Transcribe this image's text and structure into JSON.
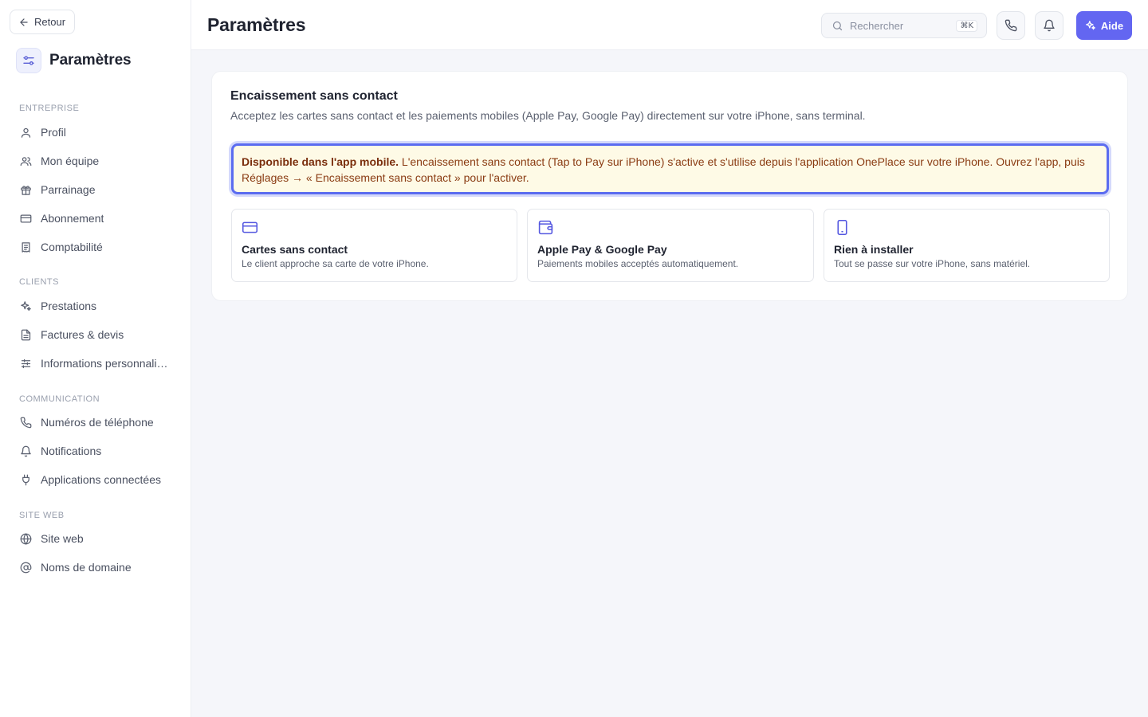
{
  "sidebar": {
    "back_label": "Retour",
    "title": "Paramètres",
    "sections": [
      {
        "label": "ENTREPRISE",
        "items": [
          {
            "label": "Profil",
            "icon": "user-icon"
          },
          {
            "label": "Mon équipe",
            "icon": "users-icon"
          },
          {
            "label": "Parrainage",
            "icon": "gift-icon"
          },
          {
            "label": "Abonnement",
            "icon": "credit-card-icon"
          },
          {
            "label": "Comptabilité",
            "icon": "receipt-icon"
          }
        ]
      },
      {
        "label": "CLIENTS",
        "items": [
          {
            "label": "Prestations",
            "icon": "sparkles-icon"
          },
          {
            "label": "Factures & devis",
            "icon": "file-text-icon"
          },
          {
            "label": "Informations personnalis…",
            "icon": "sliders-icon"
          }
        ]
      },
      {
        "label": "COMMUNICATION",
        "items": [
          {
            "label": "Numéros de téléphone",
            "icon": "phone-icon"
          },
          {
            "label": "Notifications",
            "icon": "bell-icon"
          },
          {
            "label": "Applications connectées",
            "icon": "plug-icon"
          }
        ]
      },
      {
        "label": "SITE WEB",
        "items": [
          {
            "label": "Site web",
            "icon": "globe-icon"
          },
          {
            "label": "Noms de domaine",
            "icon": "at-sign-icon"
          }
        ]
      }
    ]
  },
  "header": {
    "title": "Paramètres",
    "search_placeholder": "Rechercher",
    "search_shortcut": "⌘K",
    "help_label": "Aide"
  },
  "main": {
    "card_title": "Encaissement sans contact",
    "card_subtitle": "Acceptez les cartes sans contact et les paiements mobiles (Apple Pay, Google Pay) directement sur votre iPhone, sans terminal.",
    "notice_bold": "Disponible dans l'app mobile.",
    "notice_text": " L'encaissement sans contact (Tap to Pay sur iPhone) s'active et s'utilise depuis l'application OnePlace sur votre iPhone. Ouvrez l'app, puis Réglages → « Encaissement sans contact » pour l'activer.",
    "features": [
      {
        "title": "Cartes sans contact",
        "desc": "Le client approche sa carte de votre iPhone.",
        "icon": "credit-card-icon"
      },
      {
        "title": "Apple Pay & Google Pay",
        "desc": "Paiements mobiles acceptés automatiquement.",
        "icon": "wallet-icon"
      },
      {
        "title": "Rien à installer",
        "desc": "Tout se passe sur votre iPhone, sans matériel.",
        "icon": "smartphone-icon"
      }
    ]
  },
  "colors": {
    "accent": "#6366f1",
    "notice_bg": "#fefae6",
    "notice_text": "#8a3b12",
    "notice_border": "#5b6cf0"
  }
}
